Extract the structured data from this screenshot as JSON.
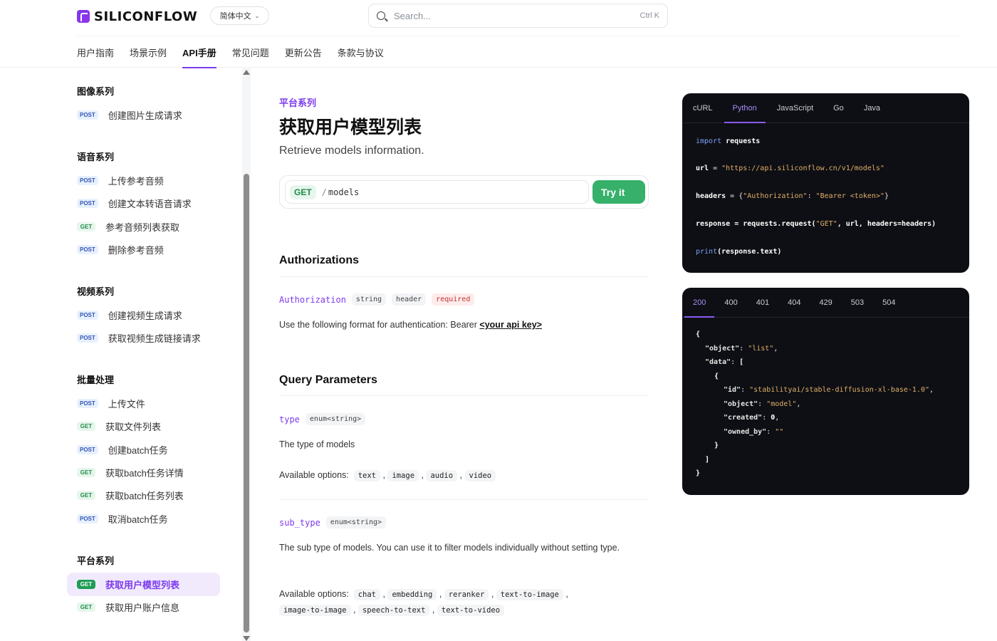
{
  "header": {
    "brand": "SILICONFLOW",
    "language": "简体中文",
    "search_placeholder": "Search...",
    "search_shortcut": "Ctrl K",
    "tabs": [
      {
        "label": "用户指南"
      },
      {
        "label": "场景示例"
      },
      {
        "label": "API手册"
      },
      {
        "label": "常见问题"
      },
      {
        "label": "更新公告"
      },
      {
        "label": "条款与协议"
      }
    ]
  },
  "sidebar": {
    "sections": [
      {
        "title": "图像系列",
        "items": [
          {
            "method": "POST",
            "label": "创建图片生成请求"
          }
        ]
      },
      {
        "title": "语音系列",
        "items": [
          {
            "method": "POST",
            "label": "上传参考音频"
          },
          {
            "method": "POST",
            "label": "创建文本转语音请求"
          },
          {
            "method": "GET",
            "label": "参考音频列表获取"
          },
          {
            "method": "POST",
            "label": "删除参考音频"
          }
        ]
      },
      {
        "title": "视频系列",
        "items": [
          {
            "method": "POST",
            "label": "创建视频生成请求"
          },
          {
            "method": "POST",
            "label": "获取视频生成链接请求"
          }
        ]
      },
      {
        "title": "批量处理",
        "items": [
          {
            "method": "POST",
            "label": "上传文件"
          },
          {
            "method": "GET",
            "label": "获取文件列表"
          },
          {
            "method": "POST",
            "label": "创建batch任务"
          },
          {
            "method": "GET",
            "label": "获取batch任务详情"
          },
          {
            "method": "GET",
            "label": "获取batch任务列表"
          },
          {
            "method": "POST",
            "label": "取消batch任务"
          }
        ]
      },
      {
        "title": "平台系列",
        "items": [
          {
            "method": "GET",
            "label": "获取用户模型列表"
          },
          {
            "method": "GET",
            "label": "获取用户账户信息"
          }
        ]
      }
    ]
  },
  "main": {
    "eyebrow": "平台系列",
    "title": "获取用户模型列表",
    "description": "Retrieve models information.",
    "endpoint": {
      "method": "GET",
      "slash": "/",
      "path": "models",
      "try_label": "Try it"
    },
    "authorizations": {
      "heading": "Authorizations",
      "name": "Authorization",
      "type": "string",
      "location": "header",
      "required": "required",
      "text": "Use the following format for authentication: Bearer",
      "link": "<your api key>"
    },
    "query": {
      "heading": "Query Parameters",
      "options_label": "Available options:",
      "params": [
        {
          "name": "type",
          "type": "enum<string>",
          "description": "The type of models",
          "options": [
            "text",
            "image",
            "audio",
            "video"
          ]
        },
        {
          "name": "sub_type",
          "type": "enum<string>",
          "description": "The sub type of models. You can use it to filter models individually without setting type.",
          "options": [
            "chat",
            "embedding",
            "reranker",
            "text-to-image",
            "image-to-image",
            "speech-to-text",
            "text-to-video"
          ]
        }
      ]
    }
  },
  "code_panel": {
    "tabs": [
      "cURL",
      "Python",
      "JavaScript",
      "Go",
      "Java"
    ],
    "active_tab": "Python",
    "lines": {
      "l1_kw": "import",
      "l1_rest": " requests",
      "l2_var": "url",
      "l2_eq": " = ",
      "l2_str": "\"https://api.siliconflow.cn/v1/models\"",
      "l3_var": "headers",
      "l3_eq": " = {",
      "l3_key": "\"Authorization\"",
      "l3_colon": ": ",
      "l3_val": "\"Bearer <token>\"",
      "l3_end": "}",
      "l4_var": "response",
      "l4_mid": " = requests.request(",
      "l4_str": "\"GET\"",
      "l4_end": ", url, headers=headers)",
      "l5_kw": "print",
      "l5_rest": "(response.text)"
    }
  },
  "response_panel": {
    "tabs": [
      "200",
      "400",
      "401",
      "404",
      "429",
      "503",
      "504"
    ],
    "active_tab": "200",
    "json": {
      "open": "{",
      "object_key": "\"object\"",
      "object_val": "\"list\"",
      "data_key": "\"data\"",
      "data_open": "[",
      "item_open": "{",
      "id_key": "\"id\"",
      "id_val": "\"stabilityai/stable-diffusion-xl-base-1.0\"",
      "obj_key": "\"object\"",
      "obj_val": "\"model\"",
      "created_key": "\"created\"",
      "created_val": "0",
      "owned_key": "\"owned_by\"",
      "owned_val": "\"\"",
      "item_close": "}",
      "data_close": "]",
      "close": "}"
    }
  },
  "colors": {
    "accent": "#7c3aed",
    "get_badge": "#1f8a48",
    "post_badge": "#3156b5",
    "try_button": "#36b06a",
    "code_bg": "#0e0f14"
  },
  "icons": {
    "search": "search-icon",
    "chevron": "chevron-down-icon",
    "logo": "siliconflow-logo-icon"
  }
}
